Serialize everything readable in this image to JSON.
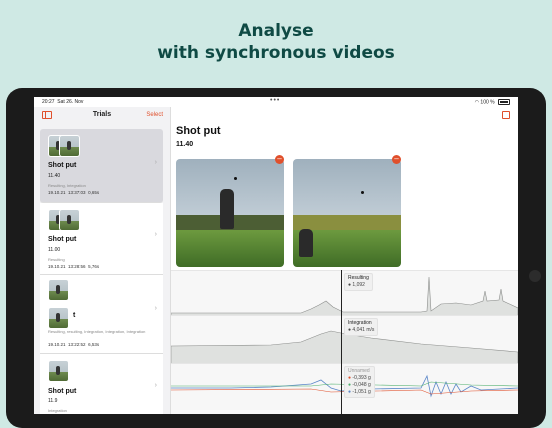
{
  "headline": {
    "line1": "Analyse",
    "line2": "with synchronous videos"
  },
  "status": {
    "time": "20:27",
    "date": "Sat 26. Nov",
    "battery": "100 %"
  },
  "sidebar": {
    "title": "Trials",
    "select_label": "Select",
    "items": [
      {
        "name": "Shot put",
        "number": "11.40",
        "tags": "Resulting, Integration",
        "date": "19.10.21",
        "time": "13:37:03",
        "speed": "0,65s",
        "selected": true
      },
      {
        "name": "Shot put",
        "number": "11.00",
        "tags": "Resulting",
        "date": "19.10.21",
        "time": "13:28:56",
        "speed": "5,76s",
        "selected": false
      },
      {
        "name": "t",
        "number": "",
        "tags": "Resulting, resulting, Integration, Integration, Integration",
        "date": "19.10.21",
        "time": "13:22:52",
        "speed": "6,53s",
        "selected": false
      },
      {
        "name": "Shot put",
        "number": "11.9",
        "tags": "Integration",
        "date": "",
        "time": "",
        "speed": "",
        "selected": false
      }
    ]
  },
  "main": {
    "title": "Shot put",
    "value": "11.40"
  },
  "charts": [
    {
      "label": "Resulting",
      "values": [
        "1,092"
      ]
    },
    {
      "label": "Integration",
      "values": [
        "4,041 m/s"
      ]
    },
    {
      "label": "Unnamed",
      "values": [
        "-0,393 g",
        "-0,048 g",
        "-1,051 g"
      ]
    }
  ],
  "colors": {
    "accent": "#e0502c",
    "headline": "#0f4a44",
    "background": "#cfe9e4"
  }
}
